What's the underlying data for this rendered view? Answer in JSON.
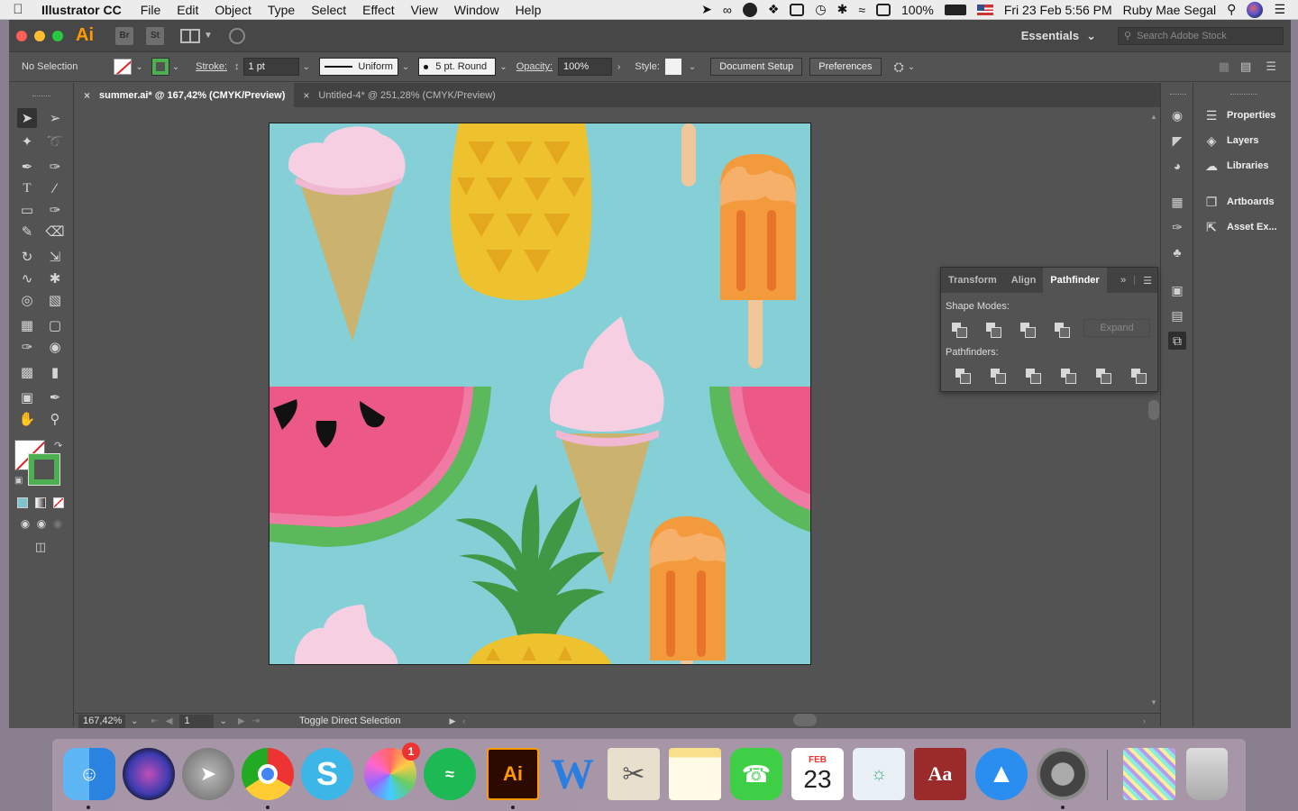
{
  "menubar": {
    "app_name": "Illustrator CC",
    "items": [
      "File",
      "Edit",
      "Object",
      "Type",
      "Select",
      "Effect",
      "View",
      "Window",
      "Help"
    ],
    "battery": "100%",
    "datetime": "Fri 23 Feb  5:56 PM",
    "user": "Ruby Mae Segal"
  },
  "appbar": {
    "logo": "Ai",
    "bridge": "Br",
    "stock": "St",
    "workspace": "Essentials",
    "search_placeholder": "Search Adobe Stock"
  },
  "controlbar": {
    "selection": "No Selection",
    "stroke_label": "Stroke:",
    "stroke_weight": "1 pt",
    "profile": "Uniform",
    "brush": "5 pt. Round",
    "opacity_label": "Opacity:",
    "opacity": "100%",
    "style_label": "Style:",
    "document_setup": "Document Setup",
    "preferences": "Preferences"
  },
  "tabs": [
    {
      "label": "summer.ai* @ 167,42% (CMYK/Preview)",
      "active": true
    },
    {
      "label": "Untitled-4* @ 251,28% (CMYK/Preview)",
      "active": false
    }
  ],
  "statusbar": {
    "zoom": "167,42%",
    "artboard": "1",
    "status": "Toggle Direct Selection"
  },
  "pathfinder": {
    "tabs": [
      "Transform",
      "Align",
      "Pathfinder"
    ],
    "shape_modes_label": "Shape Modes:",
    "pathfinders_label": "Pathfinders:",
    "expand": "Expand"
  },
  "right_panels": [
    "Properties",
    "Layers",
    "Libraries",
    "Artboards",
    "Asset Ex..."
  ],
  "dock": {
    "photos_badge": "1",
    "calendar_month": "FEB",
    "calendar_day": "23",
    "ai_label": "Ai",
    "dictionary_label": "Aa"
  },
  "colors": {
    "artboard_bg": "#84d0d6",
    "watermelon_flesh": "#ec5987",
    "watermelon_rind": "#5bb85b",
    "pineapple": "#eec22f",
    "popsicle": "#f39a3d",
    "ice_cream": "#f7cfe3",
    "cone": "#cbb26f",
    "leaves": "#3f9844",
    "accent_ai": "#ff9a00"
  }
}
